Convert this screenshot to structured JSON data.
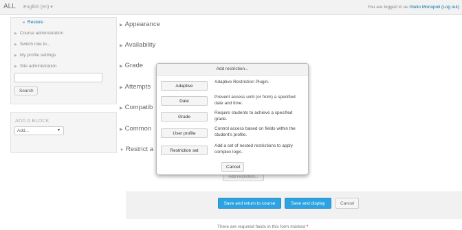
{
  "topbar": {
    "brand": "ALL",
    "language": "English (en) ▾",
    "login_prefix": "You are logged in as",
    "user": "Giulio Monopoli",
    "logout": "(Log out)"
  },
  "sidebar": {
    "items": [
      {
        "label": "Restore"
      },
      {
        "label": "Course administration"
      },
      {
        "label": "Switch role to..."
      },
      {
        "label": "My profile settings"
      },
      {
        "label": "Site administration"
      }
    ],
    "search_button": "Search",
    "add_block_title": "ADD A BLOCK",
    "add_block_select": "Add..."
  },
  "sections": [
    {
      "label": "Appearance"
    },
    {
      "label": "Availability"
    },
    {
      "label": "Grade"
    },
    {
      "label": "Attempts"
    },
    {
      "label": "Compatib"
    },
    {
      "label": "Common"
    },
    {
      "label": "Restrict a"
    }
  ],
  "behind_button": "Add restriction...",
  "footer": {
    "save_return": "Save and return to course",
    "save_display": "Save and display",
    "cancel": "Cancel",
    "required_note": "There are required fields in this form marked",
    "required_star": "*"
  },
  "modal": {
    "title": "Add restriction...",
    "rows": [
      {
        "button": "Adaptive",
        "desc": "Adaptive Restriction Plugin."
      },
      {
        "button": "Date",
        "desc": "Prevent access until (or from) a specified date and time."
      },
      {
        "button": "Grade",
        "desc": "Require students to achieve a specified grade."
      },
      {
        "button": "User profile",
        "desc": "Control access based on fields within the student's profile."
      },
      {
        "button": "Restriction set",
        "desc": "Add a set of nested restrictions to apply complex logic."
      }
    ],
    "cancel": "Cancel"
  },
  "colors": {
    "primary": "#2ea3e2",
    "link": "#0070a8",
    "required": "#cc0000"
  }
}
